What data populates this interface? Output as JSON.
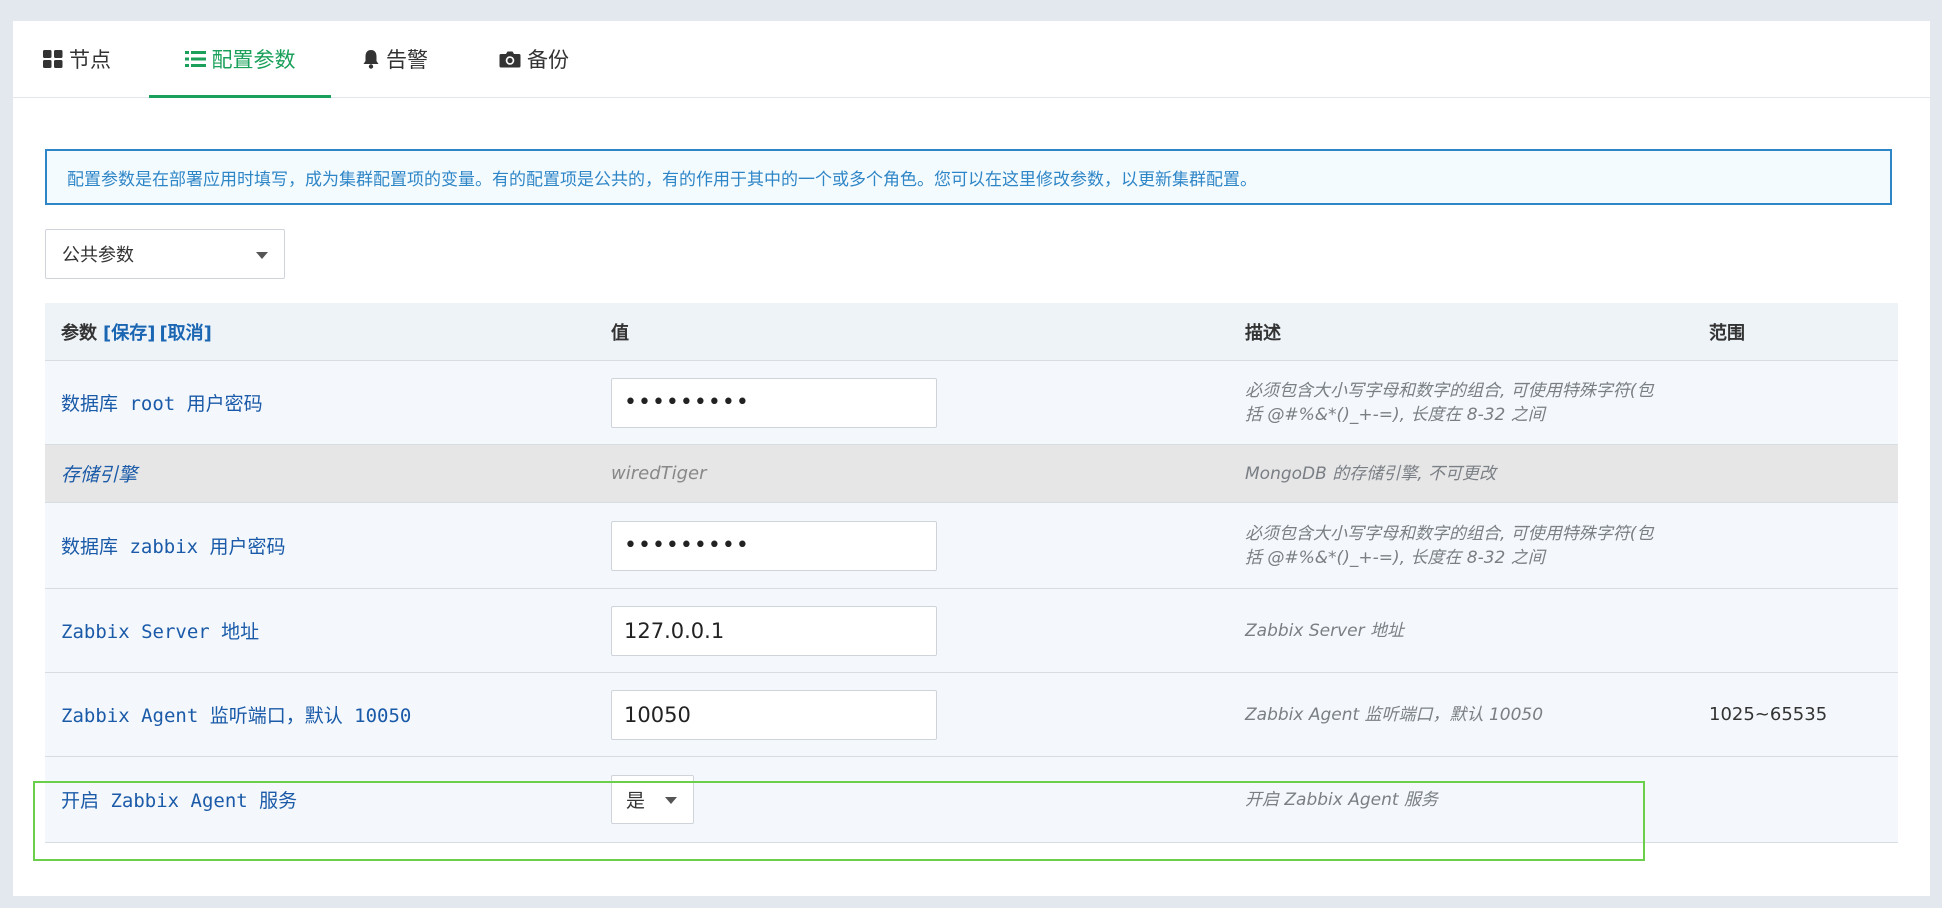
{
  "tabs": [
    {
      "label": "节点",
      "icon": "grid-icon"
    },
    {
      "label": "配置参数",
      "icon": "list-icon",
      "active": true
    },
    {
      "label": "告警",
      "icon": "bell-icon"
    },
    {
      "label": "备份",
      "icon": "camera-icon"
    }
  ],
  "info": "配置参数是在部署应用时填写，成为集群配置项的变量。有的配置项是公共的，有的作用于其中的一个或多个角色。您可以在这里修改参数，以更新集群配置。",
  "scope_select": {
    "value": "公共参数"
  },
  "table": {
    "headers": {
      "param": "参数",
      "save": "[保存]",
      "cancel": "[取消]",
      "value": "值",
      "desc": "描述",
      "range": "范围"
    },
    "rows": [
      {
        "param": "数据库 root 用户密码",
        "value": "•••••••••",
        "desc": "必须包含大小写字母和数字的组合, 可使用特殊字符(包括 @#%&*()_+-=), 长度在 8-32 之间",
        "range": ""
      },
      {
        "param": "存储引擎",
        "value": "wiredTiger",
        "desc": "MongoDB 的存储引擎, 不可更改",
        "range": ""
      },
      {
        "param": "数据库 zabbix 用户密码",
        "value": "•••••••••",
        "desc": "必须包含大小写字母和数字的组合, 可使用特殊字符(包括 @#%&*()_+-=), 长度在 8-32 之间",
        "range": ""
      },
      {
        "param": "Zabbix Server 地址",
        "value": "127.0.0.1",
        "desc": "Zabbix Server 地址",
        "range": ""
      },
      {
        "param": "Zabbix Agent 监听端口，默认 10050",
        "value": "10050",
        "desc": "Zabbix Agent 监听端口，默认 10050",
        "range": "1025~65535"
      },
      {
        "param": "开启 Zabbix Agent 服务",
        "value": "是",
        "desc": "开启 Zabbix Agent 服务",
        "range": ""
      }
    ]
  },
  "colors": {
    "accent": "#1aa05a",
    "link": "#1a66b3",
    "info_border": "#2f86c7",
    "highlight": "#6ccf4c"
  }
}
